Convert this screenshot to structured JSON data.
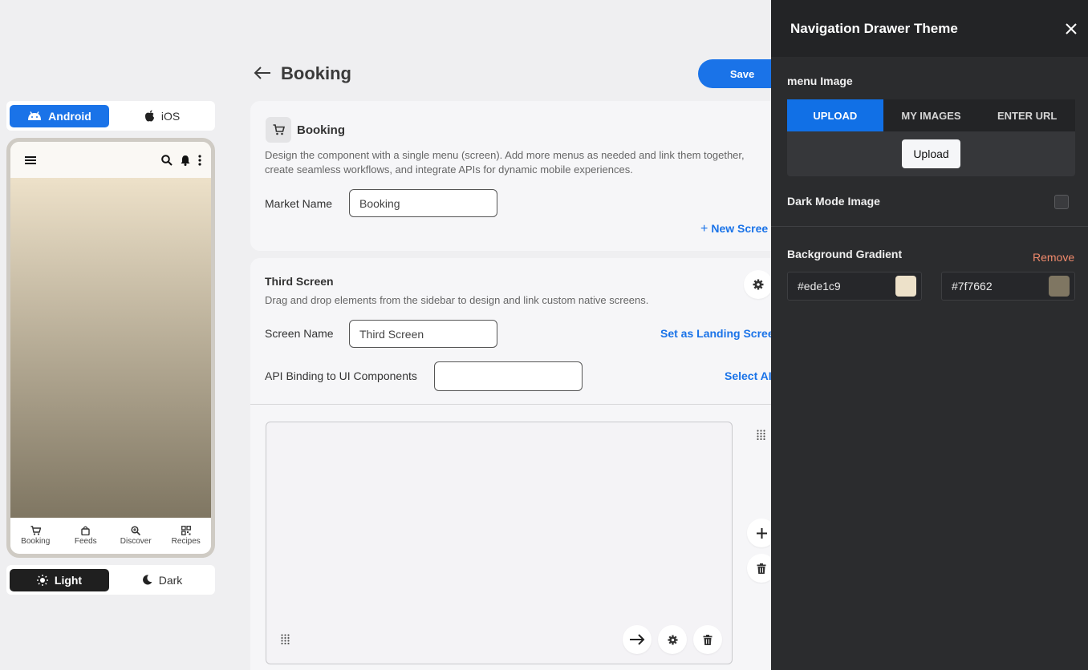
{
  "platform_toggle": {
    "android": "Android",
    "ios": "iOS"
  },
  "phone_preview": {
    "nav_items": [
      {
        "label": "Booking",
        "icon": "cart-icon"
      },
      {
        "label": "Feeds",
        "icon": "bag-icon"
      },
      {
        "label": "Discover",
        "icon": "zoom-icon"
      },
      {
        "label": "Recipes",
        "icon": "qr-icon"
      }
    ]
  },
  "theme_toggle": {
    "light": "Light",
    "dark": "Dark"
  },
  "header": {
    "title": "Booking",
    "save_label": "Save"
  },
  "component_card": {
    "title": "Booking",
    "description_line1": "Design the component with a single menu (screen). Add more menus as needed and link them together,",
    "description_line2": "create seamless workflows, and integrate APIs for dynamic mobile experiences.",
    "market_name_label": "Market Name",
    "market_name_value": "Booking",
    "new_screen_label": "New Scree"
  },
  "screen_card": {
    "title": "Third Screen",
    "description": "Drag and drop elements from the sidebar to design and link custom native screens.",
    "screen_name_label": "Screen Name",
    "screen_name_value": "Third Screen",
    "set_landing_label": "Set as Landing Scree",
    "api_binding_label": "API Binding to UI Components",
    "api_binding_value": "",
    "select_api_label": "Select AI"
  },
  "drawer": {
    "title": "Navigation Drawer Theme",
    "menu_image_label": "menu Image",
    "tabs": [
      "UPLOAD",
      "MY IMAGES",
      "ENTER URL"
    ],
    "upload_button": "Upload",
    "dark_mode_label": "Dark Mode Image",
    "gradient_label": "Background Gradient",
    "remove_label": "Remove",
    "gradient_start": "#ede1c9",
    "gradient_end": "#7f7662"
  },
  "colors": {
    "accent": "#1a73e8",
    "remove": "#f08a6c",
    "gradient_start": "#ede1c9",
    "gradient_end": "#7f7662"
  }
}
